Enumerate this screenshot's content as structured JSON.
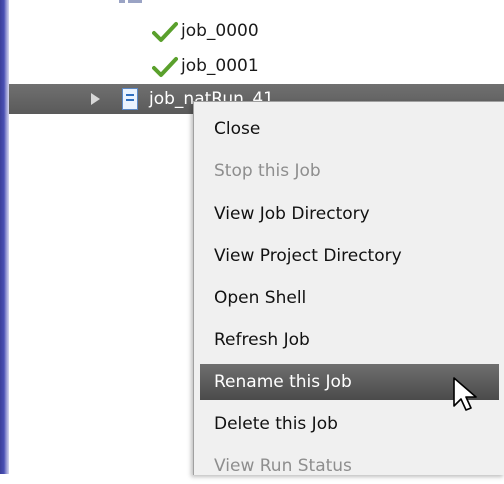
{
  "tree": {
    "rows": [
      {
        "label": "job_0000",
        "status_icon": "check-icon"
      },
      {
        "label": "job_0001",
        "status_icon": "check-icon"
      }
    ],
    "selected": {
      "label": "job_natRun_41",
      "icon": "document-icon",
      "expander": "expand-arrow-icon"
    }
  },
  "context_menu": {
    "items": [
      {
        "label": "Close",
        "enabled": true
      },
      {
        "label": "Stop this Job",
        "enabled": false
      },
      {
        "label": "View Job Directory",
        "enabled": true
      },
      {
        "label": "View Project Directory",
        "enabled": true
      },
      {
        "label": "Open Shell",
        "enabled": true
      },
      {
        "label": "Refresh Job",
        "enabled": true
      },
      {
        "label": "Rename this Job",
        "enabled": true,
        "highlighted": true
      },
      {
        "label": "Delete this Job",
        "enabled": true
      },
      {
        "label": "View Run Status",
        "enabled": false
      }
    ]
  },
  "colors": {
    "check": "#5aa02c",
    "selection": "#5f5f5f",
    "menu_background": "#f0f0f0",
    "disabled_text": "#8e8e8e"
  }
}
